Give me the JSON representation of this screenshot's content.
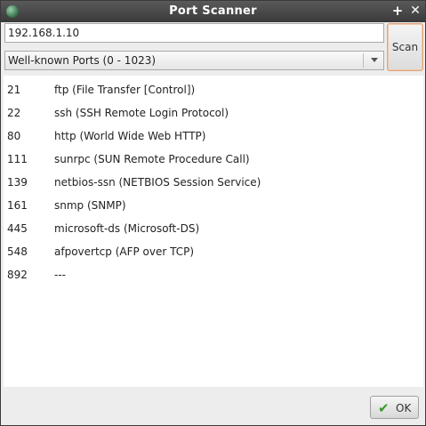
{
  "window": {
    "title": "Port Scanner"
  },
  "titlebar": {
    "maximize_glyph": "+",
    "close_glyph": "✕"
  },
  "scan_form": {
    "host_value": "192.168.1.10",
    "port_range_selected": "Well-known Ports (0 - 1023)",
    "scan_label": "Scan"
  },
  "results": [
    {
      "port": "21",
      "service": "ftp (File Transfer [Control])"
    },
    {
      "port": "22",
      "service": "ssh (SSH Remote Login Protocol)"
    },
    {
      "port": "80",
      "service": "http (World Wide Web HTTP)"
    },
    {
      "port": "111",
      "service": "sunrpc (SUN Remote Procedure Call)"
    },
    {
      "port": "139",
      "service": "netbios-ssn (NETBIOS Session Service)"
    },
    {
      "port": "161",
      "service": "snmp (SNMP)"
    },
    {
      "port": "445",
      "service": "microsoft-ds (Microsoft-DS)"
    },
    {
      "port": "548",
      "service": "afpovertcp (AFP over TCP)"
    },
    {
      "port": "892",
      "service": "---"
    }
  ],
  "footer": {
    "ok_label": "OK",
    "ok_icon": "checkmark-icon"
  }
}
